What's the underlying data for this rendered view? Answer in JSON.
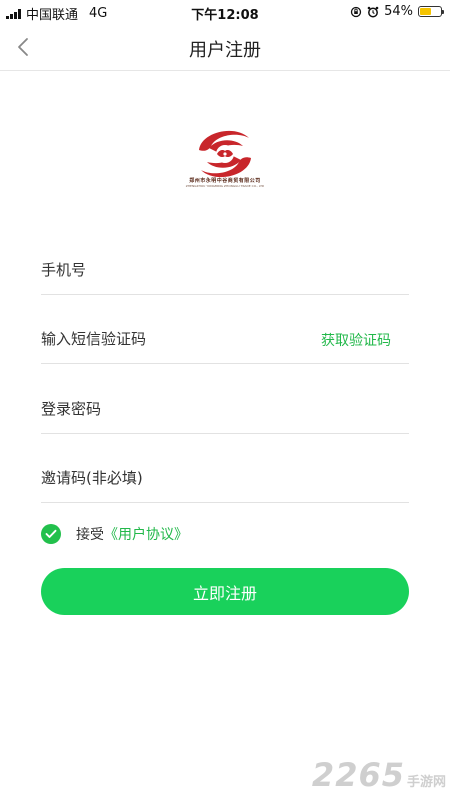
{
  "status_bar": {
    "carrier": "中国联通",
    "network": "4G",
    "time": "下午12:08",
    "battery": "54%",
    "battery_level": 0.54
  },
  "nav": {
    "title": "用户注册"
  },
  "logo": {
    "company_name": "郑州市永明中谷商贸有限公司",
    "company_name_en": "ZHENGZHOU YONGMING ZHONGGU TRADE CO., LTD"
  },
  "form": {
    "phone": {
      "placeholder": "手机号",
      "value": ""
    },
    "sms_code": {
      "placeholder": "输入短信验证码",
      "value": "",
      "get_code_label": "获取验证码"
    },
    "password": {
      "placeholder": "登录密码",
      "value": ""
    },
    "invite_code": {
      "placeholder": "邀请码(非必填)",
      "value": ""
    }
  },
  "agreement": {
    "checked": true,
    "prefix": "接受",
    "link_text": "《用户协议》"
  },
  "register_button": {
    "label": "立即注册"
  },
  "watermark": {
    "number": "2265",
    "text": "手游网"
  },
  "colors": {
    "accent": "#22b84a",
    "button": "#19d15b",
    "check": "#22c04c",
    "battery_fill": "#f5c400",
    "logo_red": "#c8262b"
  }
}
